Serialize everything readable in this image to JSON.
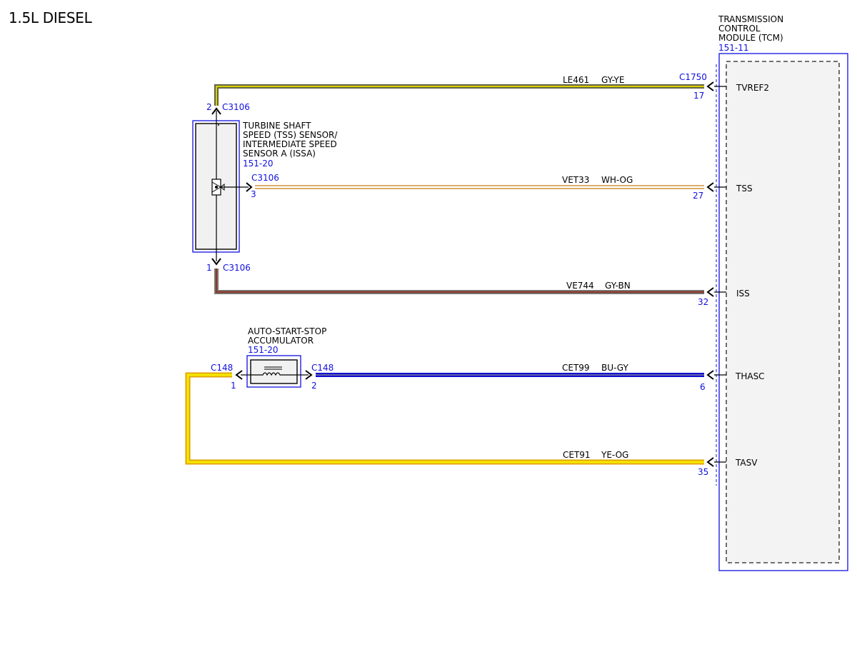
{
  "title": "1.5L DIESEL",
  "tcm": {
    "name_lines": [
      "TRANSMISSION",
      "CONTROL",
      "MODULE (TCM)"
    ],
    "ref": "151-11",
    "connector": "C1750",
    "pins": [
      {
        "num": "17",
        "name": "TVREF2"
      },
      {
        "num": "27",
        "name": "TSS"
      },
      {
        "num": "32",
        "name": "ISS"
      },
      {
        "num": "6",
        "name": "THASC"
      },
      {
        "num": "35",
        "name": "TASV"
      }
    ]
  },
  "tss_sensor": {
    "name_lines": [
      "TURBINE SHAFT",
      "SPEED (TSS) SENSOR/",
      "INTERMEDIATE SPEED",
      "SENSOR A (ISSA)"
    ],
    "ref": "151-20",
    "connector": "C3106",
    "pin_top": "2",
    "pin_signal": "3",
    "pin_bottom": "1"
  },
  "accumulator": {
    "name_lines": [
      "AUTO-START-STOP",
      "ACCUMULATOR"
    ],
    "ref": "151-20",
    "connector": "C148",
    "pin_left": "1",
    "pin_right": "2"
  },
  "wires": [
    {
      "circuit": "LE461",
      "color_code": "GY-YE",
      "colors": [
        "#6e6e5a",
        "#d8d000"
      ]
    },
    {
      "circuit": "VET33",
      "color_code": "WH-OG",
      "colors": [
        "#ffffff",
        "#e8b060"
      ]
    },
    {
      "circuit": "VE744",
      "color_code": "GY-BN",
      "colors": [
        "#7a7a7a",
        "#8b3a2a"
      ]
    },
    {
      "circuit": "CET99",
      "color_code": "BU-GY",
      "colors": [
        "#1010d0",
        "#8080a0"
      ]
    },
    {
      "circuit": "CET91",
      "color_code": "YE-OG",
      "colors": [
        "#f0e000",
        "#e8a000"
      ]
    }
  ]
}
